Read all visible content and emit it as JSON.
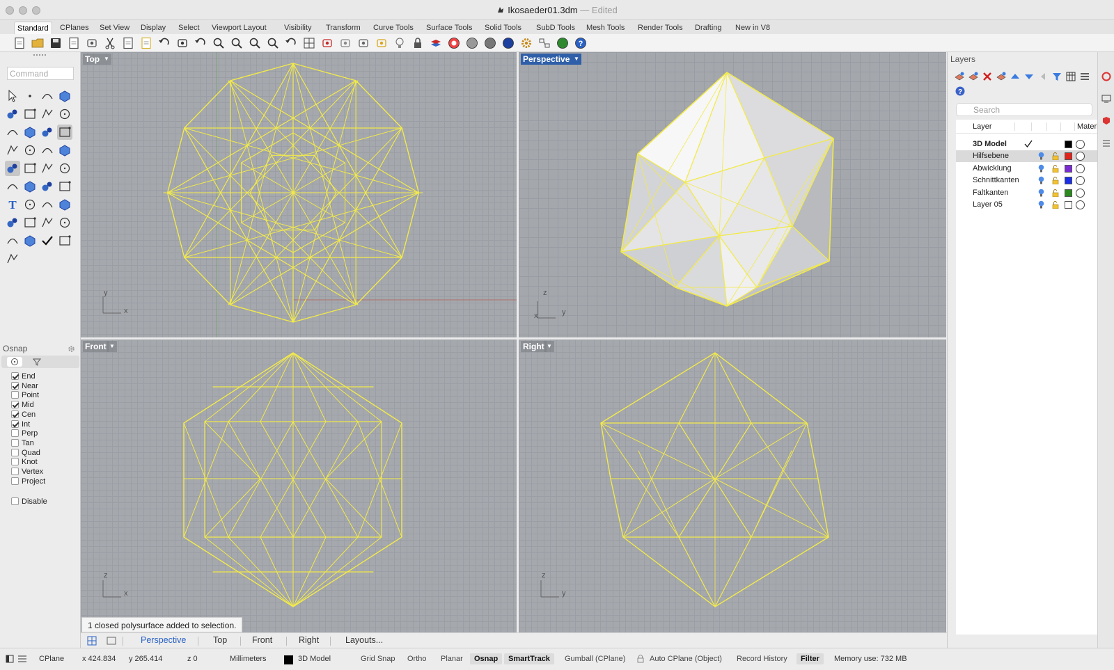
{
  "window": {
    "title": "Ikosaeder01.3dm",
    "separator": "—",
    "state": "Edited"
  },
  "tabs": [
    "Standard",
    "CPlanes",
    "Set View",
    "Display",
    "Select",
    "Viewport Layout",
    "Visibility",
    "Transform",
    "Curve Tools",
    "Surface Tools",
    "Solid Tools",
    "SubD Tools",
    "Mesh Tools",
    "Render Tools",
    "Drafting",
    "New in V8"
  ],
  "toolbar_icons": [
    "new-file-icon",
    "open-folder-icon",
    "save-icon",
    "print-icon",
    "import-icon",
    "cut-icon",
    "copy-icon",
    "paste-icon",
    "undo-icon",
    "pan-hand-icon",
    "rotate-view-icon",
    "zoom-icon",
    "zoom-window-icon",
    "zoom-extents-icon",
    "zoom-selected-icon",
    "rotate-icon",
    "grid-layout-icon",
    "car-icon",
    "plane-icon",
    "circle-target-icon",
    "properties-icon",
    "light-bulb-icon",
    "lock-icon",
    "layers-icon",
    "color-wheel-icon",
    "shaded-sphere-icon",
    "wireframe-sphere-icon",
    "rendered-sphere-icon",
    "options-gear-icon",
    "named-views-icon",
    "earth-icon",
    "help-icon"
  ],
  "command": {
    "placeholder": "Command",
    "value": ""
  },
  "osnap": {
    "title": "Osnap",
    "items": [
      {
        "label": "End",
        "checked": true
      },
      {
        "label": "Near",
        "checked": true
      },
      {
        "label": "Point",
        "checked": false
      },
      {
        "label": "Mid",
        "checked": true
      },
      {
        "label": "Cen",
        "checked": true
      },
      {
        "label": "Int",
        "checked": true
      },
      {
        "label": "Perp",
        "checked": false
      },
      {
        "label": "Tan",
        "checked": false
      },
      {
        "label": "Quad",
        "checked": false
      },
      {
        "label": "Knot",
        "checked": false
      },
      {
        "label": "Vertex",
        "checked": false
      },
      {
        "label": "Project",
        "checked": false
      }
    ],
    "disable_label": "Disable"
  },
  "viewports": {
    "top": {
      "label": "Top",
      "axis_a": "y",
      "axis_b": "x"
    },
    "perspective": {
      "label": "Perspective",
      "axis_a": "z",
      "axis_b": "y",
      "axis_c": "x"
    },
    "front": {
      "label": "Front",
      "axis_a": "z",
      "axis_b": "x"
    },
    "right": {
      "label": "Right",
      "axis_a": "z",
      "axis_b": "y"
    }
  },
  "message": "1 closed polysurface added to selection.",
  "viewport_tabs": [
    "Perspective",
    "Top",
    "Front",
    "Right",
    "Layouts..."
  ],
  "layers": {
    "title": "Layers",
    "search_placeholder": "Search",
    "col_layer": "Layer",
    "col_material": "Material",
    "rows": [
      {
        "name": "3D Model",
        "current": true,
        "color": "#000000"
      },
      {
        "name": "Hilfsebene",
        "color": "#e2231a"
      },
      {
        "name": "Abwicklung",
        "color": "#7a2bd6"
      },
      {
        "name": "Schnittkanten",
        "color": "#1a2fe6"
      },
      {
        "name": "Faltkanten",
        "color": "#2a8a1e"
      },
      {
        "name": "Layer 05",
        "color": "#ffffff"
      }
    ]
  },
  "status": {
    "cplane": "CPlane",
    "x": "x 424.834",
    "y": "y 265.414",
    "z": "z 0",
    "units": "Millimeters",
    "layer": "3D Model",
    "grid_snap": "Grid Snap",
    "ortho": "Ortho",
    "planar": "Planar",
    "osnap": "Osnap",
    "smarttrack": "SmartTrack",
    "gumball": "Gumball (CPlane)",
    "auto_cplane": "Auto CPlane (Object)",
    "record_history": "Record History",
    "filter": "Filter",
    "memory": "Memory use: 732 MB"
  },
  "colors": {
    "wire": "#f2ea4a",
    "active_viewport": "#2f5fa8",
    "active_tab_text": "#2a62c6"
  }
}
